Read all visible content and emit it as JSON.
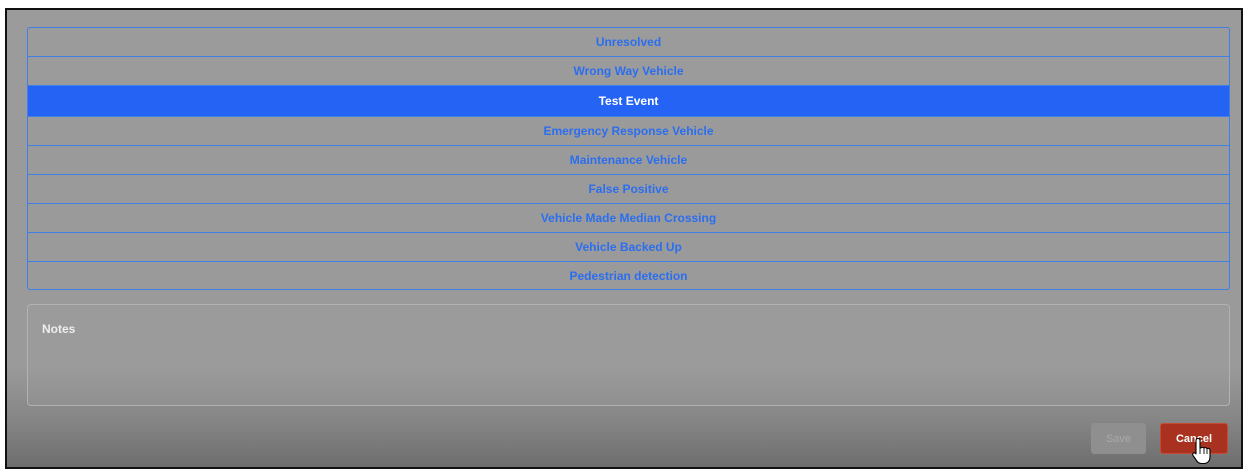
{
  "options": [
    {
      "label": "Unresolved",
      "selected": false
    },
    {
      "label": "Wrong Way Vehicle",
      "selected": false
    },
    {
      "label": "Test Event",
      "selected": true
    },
    {
      "label": "Emergency Response Vehicle",
      "selected": false
    },
    {
      "label": "Maintenance Vehicle",
      "selected": false
    },
    {
      "label": "False Positive",
      "selected": false
    },
    {
      "label": "Vehicle Made Median Crossing",
      "selected": false
    },
    {
      "label": "Vehicle Backed Up",
      "selected": false
    },
    {
      "label": "Pedestrian detection",
      "selected": false
    }
  ],
  "notes": {
    "label": "Notes",
    "value": ""
  },
  "actions": {
    "save_label": "Save",
    "cancel_label": "Cancel"
  },
  "colors": {
    "selected_bg": "#2563f5",
    "option_text": "#2b6ef0",
    "cancel_bg": "#a8321f"
  },
  "cursor": {
    "icon": "hand-pointer-icon"
  }
}
